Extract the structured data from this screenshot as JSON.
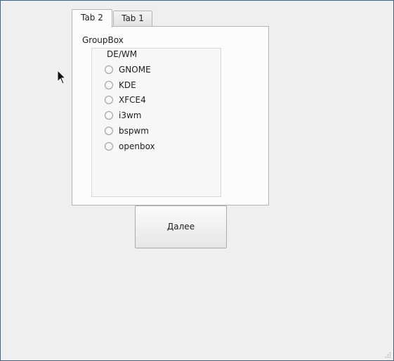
{
  "tabs": [
    {
      "label": "Tab 2",
      "active": true
    },
    {
      "label": "Tab 1",
      "active": false
    }
  ],
  "groupbox": {
    "title": "GroupBox",
    "frame_title": "DE/WM",
    "options": [
      "GNOME",
      "KDE",
      "XFCE4",
      "i3wm",
      "bspwm",
      "openbox"
    ]
  },
  "next_button": {
    "label": "Далее"
  },
  "colors": {
    "window_bg": "#efefef",
    "pane_bg": "#fcfcfc",
    "window_border": "#4a5f7a"
  }
}
